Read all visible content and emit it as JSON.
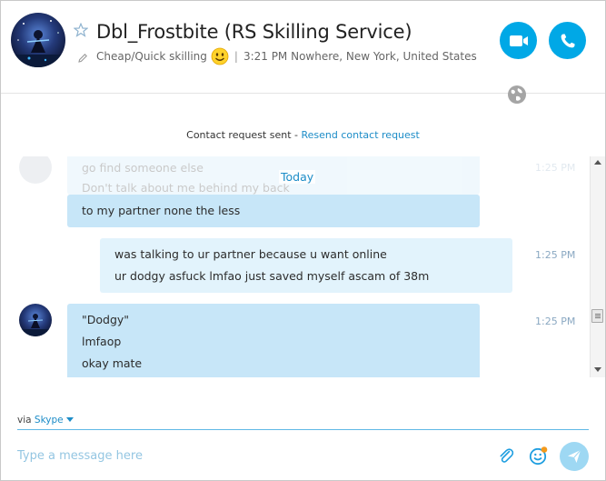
{
  "header": {
    "title": "Dbl_Frostbite (RS Skilling Service)",
    "mood": "Cheap/Quick skilling",
    "separator": "|",
    "local_info": "3:21 PM Nowhere, New York, United States"
  },
  "notice": {
    "text": "Contact request sent - ",
    "link": "Resend contact request"
  },
  "conversation": {
    "day_label": "Today",
    "faded_lines": [
      "go find someone else",
      "Don't talk about me behind my back"
    ],
    "faded_time": "1:25 PM",
    "messages": [
      {
        "lines": [
          "to my partner none the less"
        ]
      },
      {
        "lines": [
          "was talking to ur partner because u want online",
          "ur dodgy asfuck lmfao just saved myself ascam of 38m"
        ],
        "time": "1:25 PM"
      },
      {
        "lines": [
          "\"Dodgy\"",
          "lmfaop",
          "okay mate"
        ],
        "time": "1:25 PM"
      }
    ]
  },
  "compose": {
    "via_label": "via",
    "service": "Skype",
    "placeholder": "Type a message here"
  },
  "colors": {
    "accent": "#00a8e6",
    "bubble_incoming": "#c7e6f8",
    "bubble_outgoing": "#e2f3fc",
    "link": "#1c8cc7"
  },
  "icons": [
    "video-call-icon",
    "phone-call-icon",
    "star-icon",
    "pen-icon",
    "smiley-icon",
    "globe-icon",
    "paperclip-icon",
    "emoticon-icon",
    "send-icon"
  ]
}
